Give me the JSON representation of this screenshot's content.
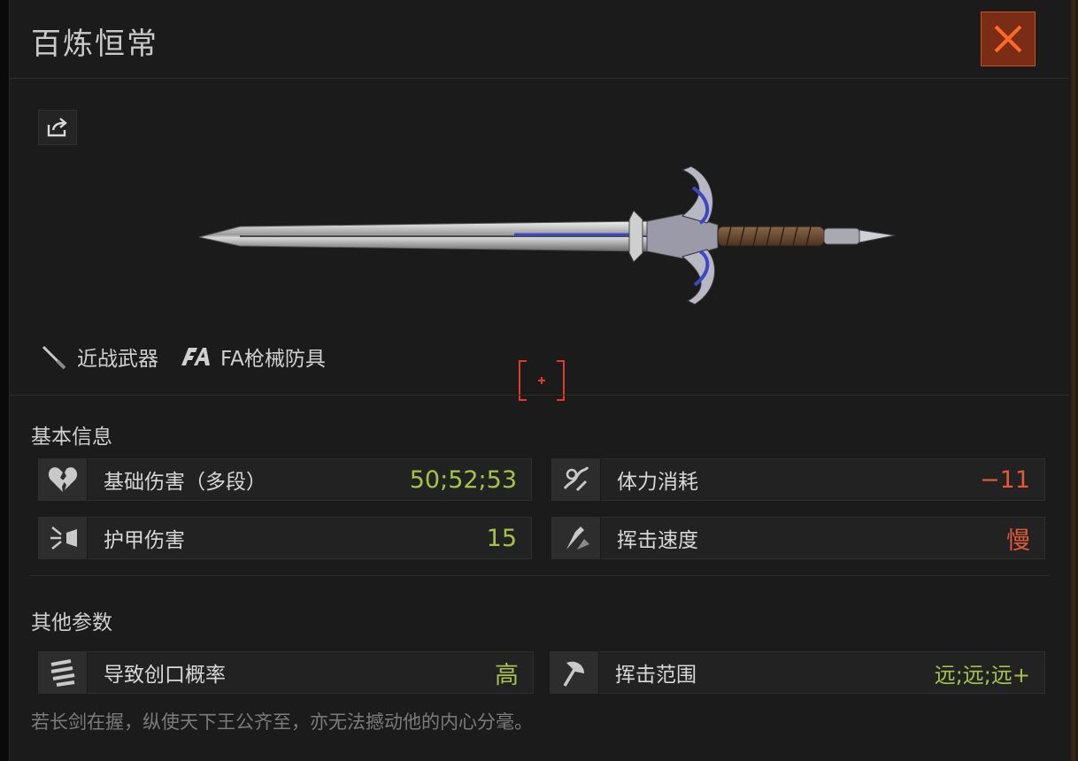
{
  "header": {
    "title": "百炼恒常"
  },
  "item": {
    "tags": [
      {
        "icon": "knife-icon",
        "label": "近战武器"
      },
      {
        "icon": "fa-logo-icon",
        "label": "FA枪械防具"
      }
    ]
  },
  "basic": {
    "section_title": "基本信息",
    "stats": [
      {
        "icon": "broken-heart-icon",
        "label": "基础伤害（多段）",
        "value": "50;52;53",
        "color": "#a6c24a"
      },
      {
        "icon": "stamina-icon",
        "label": "体力消耗",
        "value": "−11",
        "color": "#e05a3a"
      },
      {
        "icon": "armor-damage-icon",
        "label": "护甲伤害",
        "value": "15",
        "color": "#a6c24a"
      },
      {
        "icon": "swing-speed-icon",
        "label": "挥击速度",
        "value": "慢",
        "color": "#e05a3a"
      }
    ]
  },
  "other": {
    "section_title": "其他参数",
    "stats": [
      {
        "icon": "bleed-icon",
        "label": "导致创口概率",
        "value": "高",
        "color": "#a6c24a"
      },
      {
        "icon": "axe-range-icon",
        "label": "挥击范围",
        "value": "远;远;远+",
        "color": "#a6c24a"
      }
    ]
  },
  "description": "若长剑在握，纵使天下王公齐至，亦无法撼动他的内心分毫。"
}
